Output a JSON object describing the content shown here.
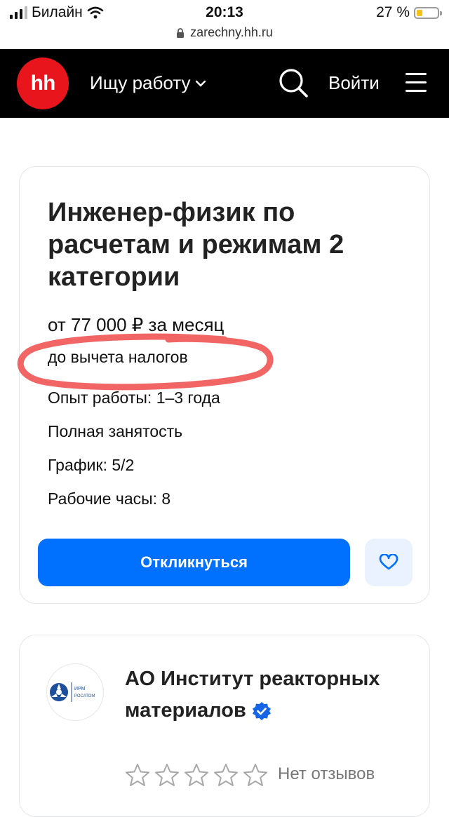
{
  "status_bar": {
    "carrier": "Билайн",
    "time": "20:13",
    "battery": "27 %",
    "battery_level": 0.27
  },
  "url": "zarechny.hh.ru",
  "header": {
    "logo": "hh",
    "job_select": "Ищу работу",
    "login": "Войти"
  },
  "vacancy": {
    "title": "Инженер-физик по расчетам и режимам 2 категории",
    "salary": "от 77 000 ₽ за месяц",
    "tax_note": "до вычета налогов",
    "experience": "Опыт работы: 1–3 года",
    "employment": "Полная занятость",
    "schedule": "График: 5/2",
    "hours": "Рабочие часы: 8",
    "apply_label": "Откликнуться"
  },
  "company": {
    "logo_text_1": "ИРМ",
    "logo_text_2": "РОСАТОМ",
    "name": "АО Институт реакторных материалов",
    "rating_stars": 0,
    "reviews": "Нет отзывов"
  },
  "colors": {
    "brand_red": "#e8161c",
    "primary_blue": "#0070ff",
    "highlight": "#f04a4a"
  }
}
